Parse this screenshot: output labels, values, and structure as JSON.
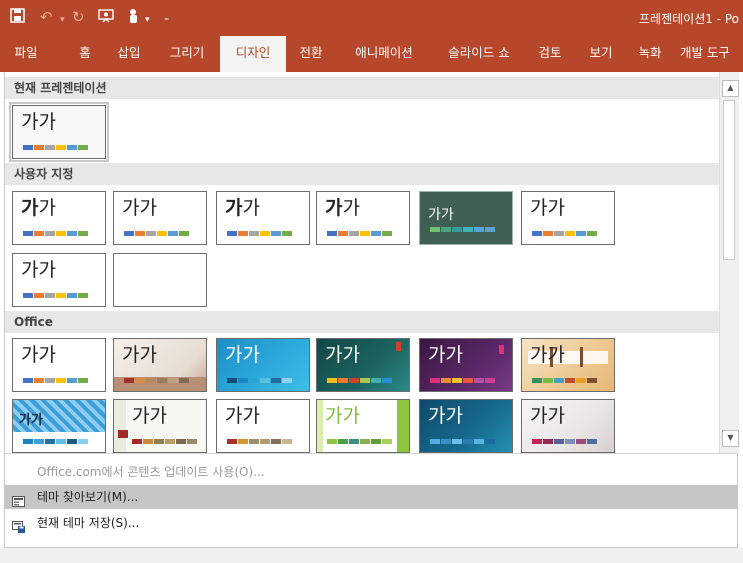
{
  "colors": {
    "accent": "#b7472a",
    "section_bg": "#e7e7e7",
    "highlight": "#c6c6c6"
  },
  "titlebar": {
    "icons": [
      "save-icon",
      "undo-icon",
      "redo-icon",
      "present-from-start-icon",
      "touch-mode-icon",
      "customize-qat-icon"
    ],
    "doc_title": "프레젠테이션1  -  Po"
  },
  "ribbon": {
    "tabs": [
      {
        "label": "파일",
        "active": false
      },
      {
        "label": "홈",
        "active": false
      },
      {
        "label": "삽입",
        "active": false
      },
      {
        "label": "그리기",
        "active": false
      },
      {
        "label": "디자인",
        "active": true
      },
      {
        "label": "전환",
        "active": false
      },
      {
        "label": "애니메이션",
        "active": false
      },
      {
        "label": "슬라이드 쇼",
        "active": false
      },
      {
        "label": "검토",
        "active": false
      },
      {
        "label": "보기",
        "active": false
      },
      {
        "label": "녹화",
        "active": false
      },
      {
        "label": "개발 도구",
        "active": false
      }
    ]
  },
  "gallery": {
    "sections": [
      {
        "title": "현재 프레젠테이션",
        "themes": [
          {
            "sample": "가가",
            "style": "plain"
          }
        ]
      },
      {
        "title": "사용자 지정",
        "themes": [
          {
            "sample": "가가",
            "style": "bold-first"
          },
          {
            "sample": "가가",
            "style": "plain"
          },
          {
            "sample": "가가",
            "style": "bold-first"
          },
          {
            "sample": "가가",
            "style": "bold-first"
          },
          {
            "sample": "가가",
            "style": "dark-green"
          },
          {
            "sample": "가가",
            "style": "plain"
          },
          {
            "sample": "가가",
            "style": "plain"
          },
          {
            "sample": "",
            "style": "blank"
          }
        ]
      },
      {
        "title": "Office",
        "themes": [
          {
            "sample": "가가",
            "style": "office"
          },
          {
            "sample": "가가",
            "style": "wood-light"
          },
          {
            "sample": "가가",
            "style": "blue-light"
          },
          {
            "sample": "가가",
            "style": "dark-teal"
          },
          {
            "sample": "가가",
            "style": "purple"
          },
          {
            "sample": "가가",
            "style": "orange-paper"
          },
          {
            "sample": "가가",
            "style": "blue-pattern"
          },
          {
            "sample": "가가",
            "style": "cream-red"
          },
          {
            "sample": "가가",
            "style": "plain-gray"
          },
          {
            "sample": "가가",
            "style": "green-facet"
          },
          {
            "sample": "가가",
            "style": "blue-ion"
          },
          {
            "sample": "가가",
            "style": "gray-red"
          }
        ]
      }
    ]
  },
  "menu": {
    "update": "Office.com에서 콘텐츠 업데이트 사용(O)...",
    "browse": "테마 찾아보기(M)...",
    "save": "현재 테마 저장(S)..."
  }
}
